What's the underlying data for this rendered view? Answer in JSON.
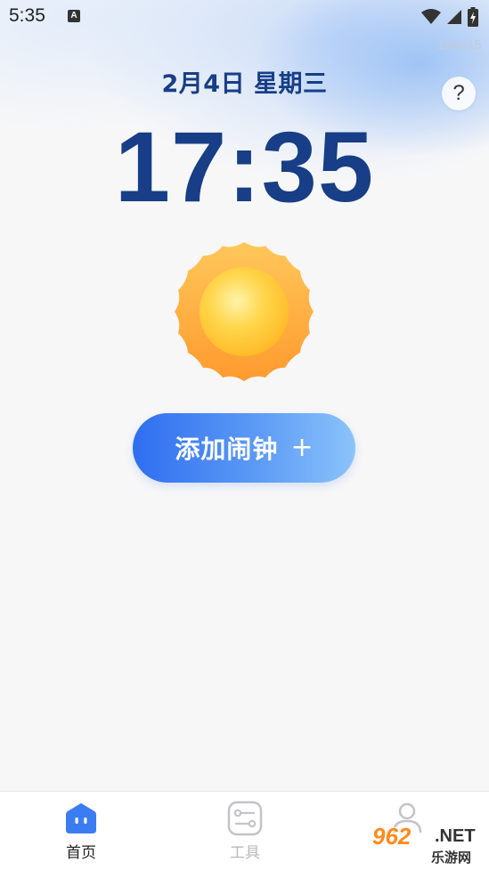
{
  "status_bar": {
    "time": "5:35",
    "notification_badge": "A",
    "icons": [
      "wifi-icon",
      "signal-icon",
      "battery-icon"
    ]
  },
  "version": "1a0e15",
  "header": {
    "date": "2月4日 星期三",
    "help_label": "?"
  },
  "clock": {
    "time": "17:35"
  },
  "weather_icon": "sun-icon",
  "add_alarm": {
    "label": "添加闹钟",
    "plus": "+"
  },
  "bottom_nav": {
    "items": [
      {
        "label": "首页",
        "icon": "home-robot-icon",
        "active": true
      },
      {
        "label": "工具",
        "icon": "tools-icon",
        "active": false
      },
      {
        "label": "",
        "icon": "profile-icon",
        "active": false
      }
    ]
  },
  "watermark": {
    "brand": "962",
    "suffix": ".NET",
    "sub": "乐游网"
  },
  "colors": {
    "primary_text": "#173e86",
    "button_start": "#2f6ef0",
    "button_end": "#8cc3fb",
    "nav_active": "#3b7cf3",
    "nav_inactive": "#c4c4c8"
  }
}
